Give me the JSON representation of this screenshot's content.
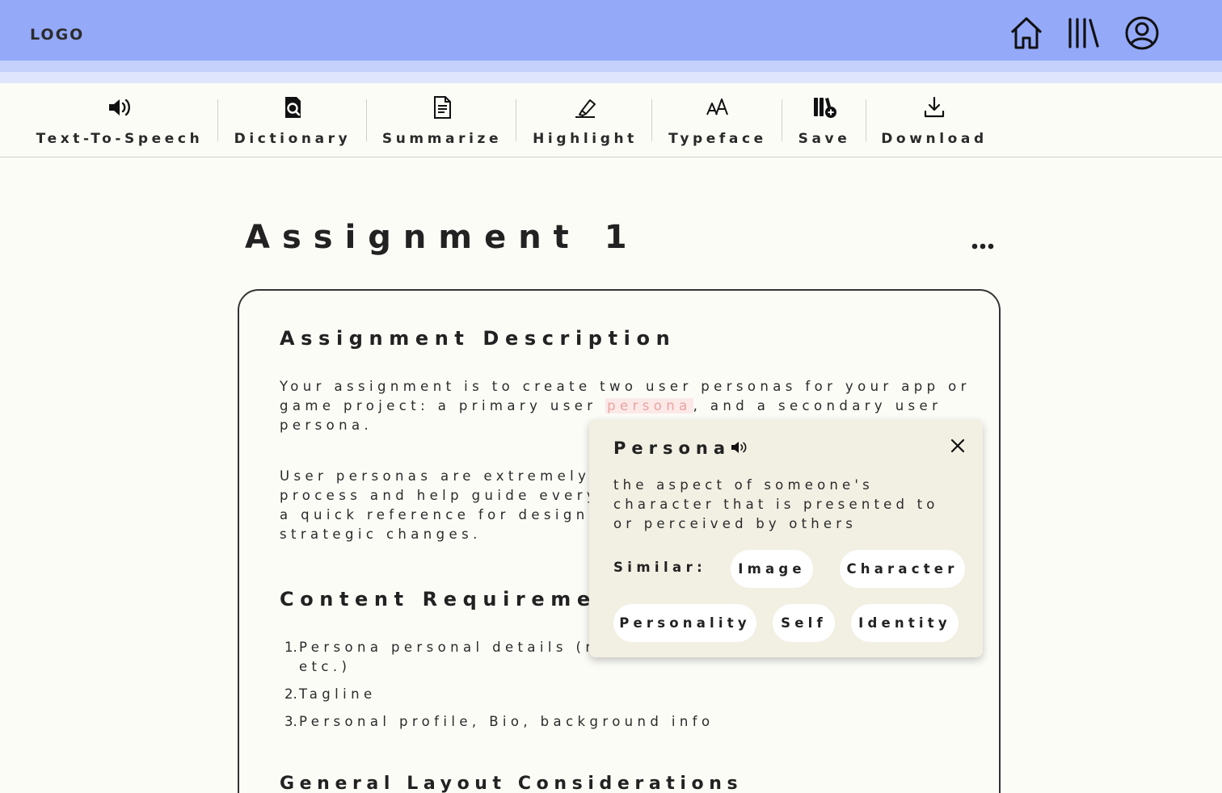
{
  "header": {
    "logo": "LOGO",
    "icons": [
      "home-icon",
      "library-icon",
      "account-icon"
    ]
  },
  "toolbar": {
    "items": [
      {
        "label": "Text-To-Speech",
        "icon": "speaker-icon"
      },
      {
        "label": "Dictionary",
        "icon": "dictionary-icon"
      },
      {
        "label": "Summarize",
        "icon": "document-icon"
      },
      {
        "label": "Highlight",
        "icon": "highlighter-icon"
      },
      {
        "label": "Typeface",
        "icon": "typeface-icon"
      },
      {
        "label": "Save",
        "icon": "save-library-icon"
      },
      {
        "label": "Download",
        "icon": "download-icon"
      }
    ]
  },
  "page": {
    "title": "Assignment 1"
  },
  "content": {
    "description_heading": "Assignment Description",
    "para1_before": "Your assignment is to create two user personas for your app or game project: a primary user ",
    "para1_highlight": "persona",
    "para1_after": ", and a secondary user persona.",
    "para2_lines": [
      "User personas are extremely h",
      "process and help guide every",
      "a quick reference for design d",
      "strategic changes."
    ],
    "requirements_heading": "Content Requiremen",
    "requirements": [
      {
        "num": "1.",
        "lines": [
          "Persona personal details (na",
          "etc.)"
        ]
      },
      {
        "num": "2.",
        "lines": [
          "Tagline"
        ]
      },
      {
        "num": "3.",
        "lines": [
          "Personal profile, Bio, background info"
        ]
      }
    ],
    "layout_heading": "General Layout Considerations"
  },
  "popup": {
    "word": "Persona",
    "definition": "the aspect of someone's character that is presented to or perceived by others",
    "similar_label": "Similar:",
    "similar_words": [
      "Image",
      "Character",
      "Personality",
      "Self",
      "Identity"
    ]
  },
  "colors": {
    "header": "#94a9f8",
    "header_band": "#c5d0fb",
    "background": "#fcfcf7",
    "popup": "#f2efe3",
    "highlight_text": "#e9a3a3",
    "highlight_bg": "#fbe9e7"
  }
}
